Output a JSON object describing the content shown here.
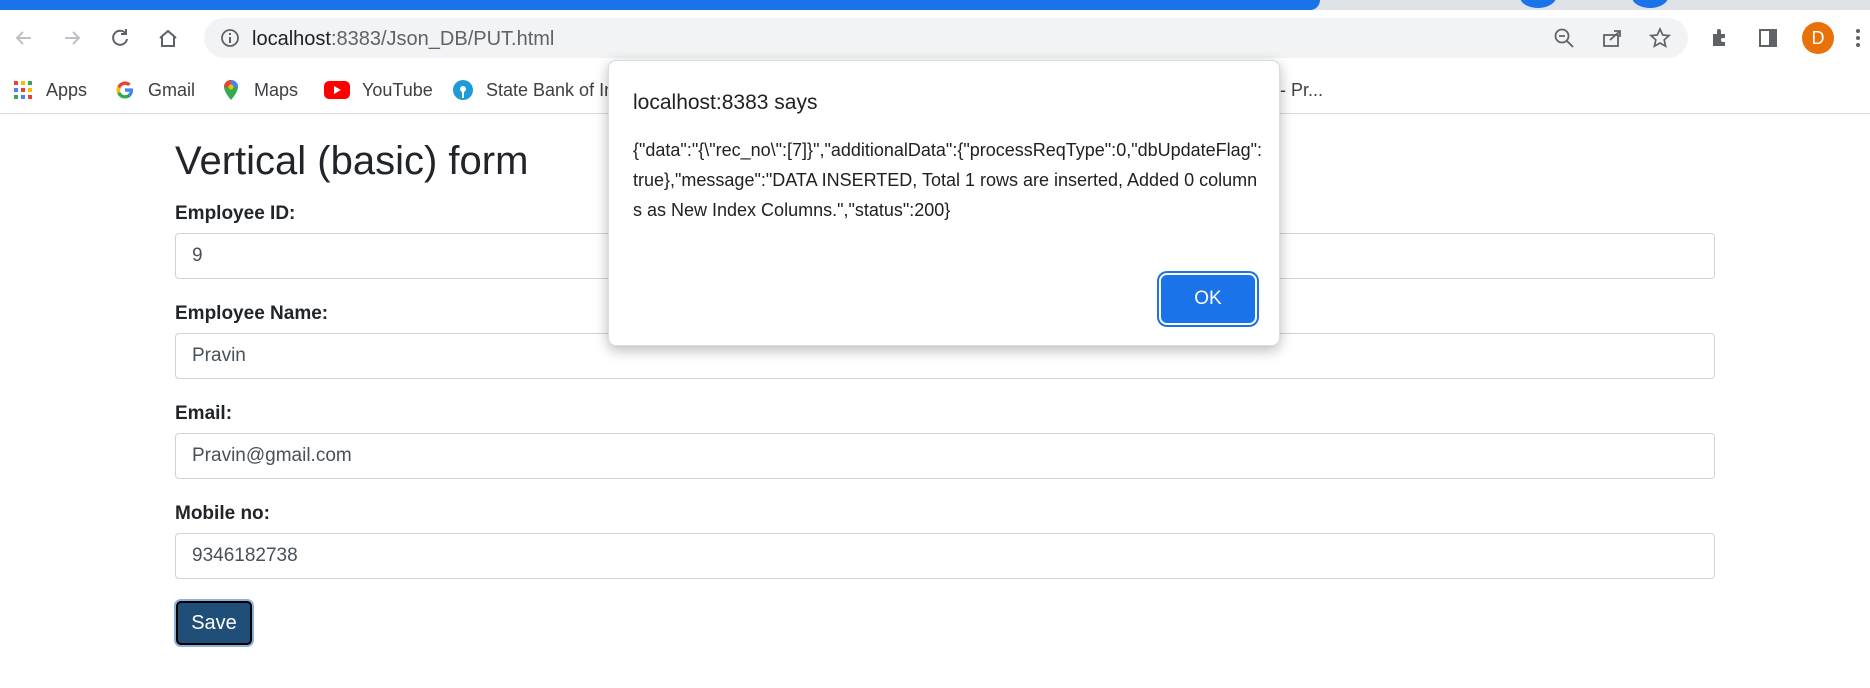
{
  "browser": {
    "url_host": "localhost",
    "url_path": ":8383/Json_DB/PUT.html",
    "avatar_letter": "D",
    "accent_color": "#1a73e8",
    "avatar_color": "#e8710a"
  },
  "bookmarks": [
    {
      "label": "Apps",
      "icon": "apps-grid-icon"
    },
    {
      "label": "Gmail",
      "icon": "google-icon"
    },
    {
      "label": "Maps",
      "icon": "maps-pin-icon"
    },
    {
      "label": "YouTube",
      "icon": "youtube-icon"
    },
    {
      "label": "State Bank of In",
      "icon": "sbi-icon"
    },
    {
      "label": "- Pr...",
      "icon": ""
    }
  ],
  "form": {
    "title": "Vertical (basic) form",
    "fields": [
      {
        "label": "Employee ID:",
        "value": "9"
      },
      {
        "label": "Employee Name:",
        "value": "Pravin"
      },
      {
        "label": "Email:",
        "value": "Pravin@gmail.com"
      },
      {
        "label": "Mobile no:",
        "value": "9346182738"
      }
    ],
    "save_label": "Save",
    "save_color": "#1f4e79"
  },
  "dialog": {
    "title": "localhost:8383 says",
    "message": "{\"data\":\"{\\\"rec_no\\\":[7]}\",\"additionalData\":{\"processReqType\":0,\"dbUpdateFlag\":true},\"message\":\"DATA INSERTED, Total 1 rows are inserted, Added 0 columns as New Index Columns.\",\"status\":200}",
    "ok_label": "OK"
  }
}
